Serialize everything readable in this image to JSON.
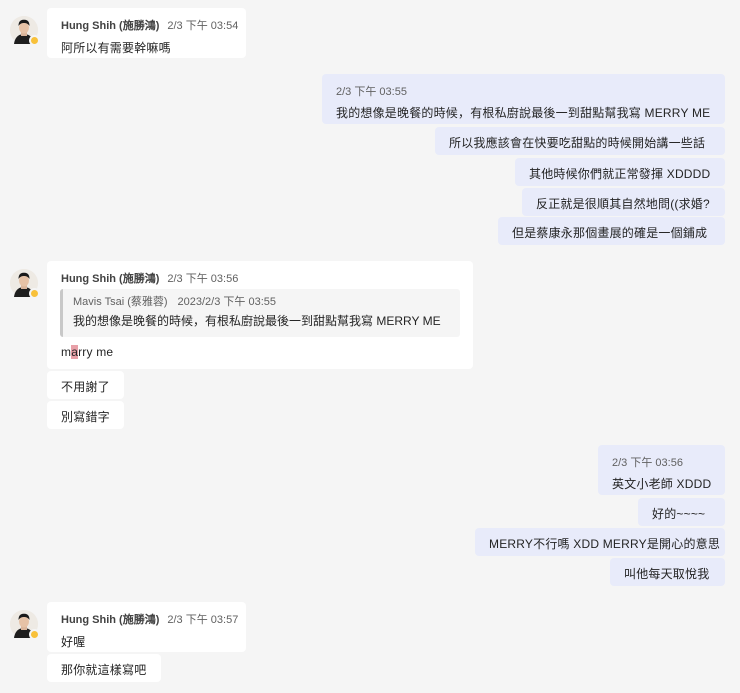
{
  "group1": {
    "author": "Hung Shih (施勝鴻)",
    "time": "2/3 下午 03:54",
    "text": "阿所以有需要幹嘛嗎"
  },
  "group2": {
    "time": "2/3 下午 03:55",
    "messages": [
      "我的想像是晚餐的時候，有根私廚說最後一到甜點幫我寫 MERRY ME",
      "所以我應該會在快要吃甜點的時候開始講一些話",
      "其他時候你們就正常發揮 XDDDD",
      "反正就是很順其自然地問((求婚?",
      "但是蔡康永那個畫展的確是一個鋪成"
    ]
  },
  "group3": {
    "author": "Hung Shih (施勝鴻)",
    "time": "2/3 下午 03:56",
    "quote": {
      "author": "Mavis Tsai (蔡雅蓉)",
      "time": "2023/2/3 下午 03:55",
      "text": "我的想像是晚餐的時候，有根私廚說最後一到甜點幫我寫 MERRY ME"
    },
    "reply_before": "m",
    "reply_highlight": "a",
    "reply_after": "rry me",
    "messages": [
      "不用謝了",
      "別寫錯字"
    ]
  },
  "group4": {
    "time": "2/3 下午 03:56",
    "first": "英文小老師 XDDD",
    "messages": [
      "好的~~~~",
      "MERRY不行嗎 XDD MERRY是開心的意思",
      "叫他每天取悅我"
    ]
  },
  "group5": {
    "author": "Hung Shih (施勝鴻)",
    "time": "2/3 下午 03:57",
    "text": "好喔",
    "messages": [
      "那你就這樣寫吧"
    ]
  },
  "colors": {
    "background": "#f5f5f5",
    "incoming_bubble": "#ffffff",
    "outgoing_bubble": "#e8ebfa",
    "presence_away": "#f8c13a",
    "typo_highlight": "#e8a0a8"
  },
  "icons": [
    "avatar",
    "away-presence-icon"
  ]
}
